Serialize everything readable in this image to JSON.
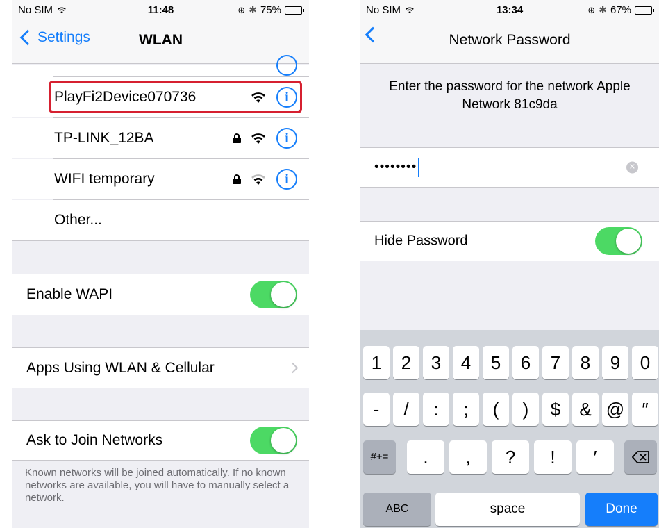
{
  "left": {
    "status": {
      "carrier": "No SIM",
      "time": "11:48",
      "battery": "75%",
      "battery_level": 0.75
    },
    "nav": {
      "back_label": "Settings",
      "title": "WLAN"
    },
    "networks": [
      {
        "name": "PlayFi2Device070736",
        "locked": false,
        "highlighted": true
      },
      {
        "name": "TP-LINK_12BA",
        "locked": true,
        "highlighted": false
      },
      {
        "name": "WIFI temporary",
        "locked": true,
        "highlighted": false
      }
    ],
    "other_label": "Other...",
    "enable_wapi": {
      "label": "Enable WAPI",
      "on": true
    },
    "apps_using": {
      "label": "Apps Using WLAN & Cellular"
    },
    "ask_join": {
      "label": "Ask to Join Networks",
      "on": true
    },
    "footnote": "Known networks will be joined automatically. If no known networks are available, you will have to manually select a network.",
    "colors": {
      "accent": "#157efb",
      "toggle_on": "#4cd964",
      "highlight": "#d62030"
    }
  },
  "right": {
    "status": {
      "carrier": "No SIM",
      "time": "13:34",
      "battery": "67%",
      "battery_level": 0.67
    },
    "nav": {
      "title": "Network Password"
    },
    "prompt_line1": "Enter the password for the network Apple",
    "prompt_line2": "Network 81c9da",
    "password_mask": "••••••••",
    "hide_password": {
      "label": "Hide Password",
      "on": true
    },
    "keyboard": {
      "row1": [
        "1",
        "2",
        "3",
        "4",
        "5",
        "6",
        "7",
        "8",
        "9",
        "0"
      ],
      "row2": [
        "-",
        "/",
        ":",
        ";",
        "(",
        ")",
        "$",
        "&",
        "@",
        "″"
      ],
      "row3": [
        ".",
        ",",
        "?",
        "!",
        "′"
      ],
      "symbols_key": "#+=",
      "abc_key": "ABC",
      "space_key": "space",
      "done_key": "Done"
    }
  }
}
